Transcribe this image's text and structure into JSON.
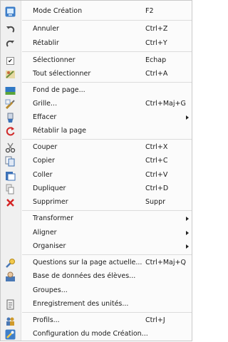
{
  "menu": {
    "items": [
      {
        "label": "Mode Création",
        "shortcut": "F2",
        "icon": "design-mode-icon"
      },
      {
        "label": "Annuler",
        "shortcut": "Ctrl+Z",
        "icon": "undo-icon"
      },
      {
        "label": "Rétablir",
        "shortcut": "Ctrl+Y",
        "icon": "redo-icon"
      },
      {
        "label": "Sélectionner",
        "shortcut": "Echap",
        "icon": "select-check-icon",
        "checked": true
      },
      {
        "label": "Tout sélectionner",
        "shortcut": "Ctrl+A",
        "icon": "select-all-icon"
      },
      {
        "label": "Fond de page...",
        "shortcut": "",
        "icon": "page-background-icon"
      },
      {
        "label": "Grille...",
        "shortcut": "Ctrl+Maj+G",
        "icon": "grid-icon"
      },
      {
        "label": "Effacer",
        "shortcut": "",
        "icon": "erase-icon",
        "submenu": true
      },
      {
        "label": "Rétablir la page",
        "shortcut": "",
        "icon": "reset-page-icon"
      },
      {
        "label": "Couper",
        "shortcut": "Ctrl+X",
        "icon": "cut-icon"
      },
      {
        "label": "Copier",
        "shortcut": "Ctrl+C",
        "icon": "copy-icon"
      },
      {
        "label": "Coller",
        "shortcut": "Ctrl+V",
        "icon": "paste-icon"
      },
      {
        "label": "Dupliquer",
        "shortcut": "Ctrl+D",
        "icon": "duplicate-icon"
      },
      {
        "label": "Supprimer",
        "shortcut": "Suppr",
        "icon": "delete-icon"
      },
      {
        "label": "Transformer",
        "shortcut": "",
        "icon": "",
        "submenu": true
      },
      {
        "label": "Aligner",
        "shortcut": "",
        "icon": "",
        "submenu": true
      },
      {
        "label": "Organiser",
        "shortcut": "",
        "icon": "",
        "submenu": true
      },
      {
        "label": "Questions sur la page actuelle...",
        "shortcut": "Ctrl+Maj+Q",
        "icon": "questions-icon"
      },
      {
        "label": "Base de données des élèves...",
        "shortcut": "",
        "icon": "student-database-icon"
      },
      {
        "label": "Groupes...",
        "shortcut": "",
        "icon": ""
      },
      {
        "label": "Enregistrement des unités...",
        "shortcut": "",
        "icon": "unit-registration-icon"
      },
      {
        "label": "Profils...",
        "shortcut": "Ctrl+J",
        "icon": "profiles-icon"
      },
      {
        "label": "Configuration du mode Création...",
        "shortcut": "",
        "icon": "design-config-icon"
      }
    ]
  },
  "colors": {
    "menu_background": "#fbfbfb",
    "gutter": "#f0f0f0",
    "separator": "#dcdcdc",
    "text": "#1a1a1a"
  }
}
